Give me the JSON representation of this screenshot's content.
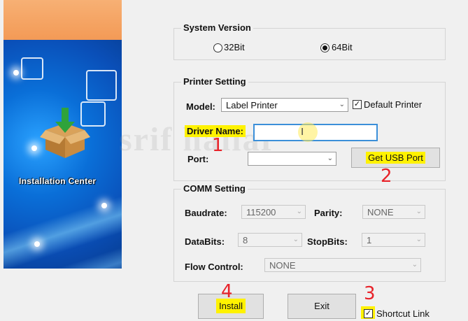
{
  "banner": {
    "label": "Installation Center",
    "icon": "box-download-icon"
  },
  "system_version": {
    "title": "System Version",
    "options": [
      {
        "label": "32Bit",
        "selected": false
      },
      {
        "label": "64Bit",
        "selected": true
      }
    ]
  },
  "printer_setting": {
    "title": "Printer Setting",
    "model_label": "Model:",
    "model_value": "Label Printer",
    "default_printer_label": "Default Printer",
    "default_printer_checked": true,
    "driver_name_label": "Driver Name:",
    "driver_name_value": "",
    "port_label": "Port:",
    "port_value": "",
    "get_usb_port_label": "Get USB Port"
  },
  "comm_setting": {
    "title": "COMM Setting",
    "baudrate_label": "Baudrate:",
    "baudrate_value": "115200",
    "parity_label": "Parity:",
    "parity_value": "NONE",
    "databits_label": "DataBits:",
    "databits_value": "8",
    "stopbits_label": "StopBits:",
    "stopbits_value": "1",
    "flow_control_label": "Flow Control:",
    "flow_control_value": "NONE"
  },
  "footer": {
    "install_label": "Install",
    "exit_label": "Exit",
    "shortcut_label": "Shortcut Link",
    "shortcut_checked": true
  },
  "annotations": {
    "mark1": "1",
    "mark2": "2",
    "mark3": "3",
    "mark4": "4"
  },
  "colors": {
    "highlight": "#fff200",
    "annotation": "#e8232a",
    "banner_blue": "#0a6fd8",
    "banner_orange": "#f39a56"
  }
}
